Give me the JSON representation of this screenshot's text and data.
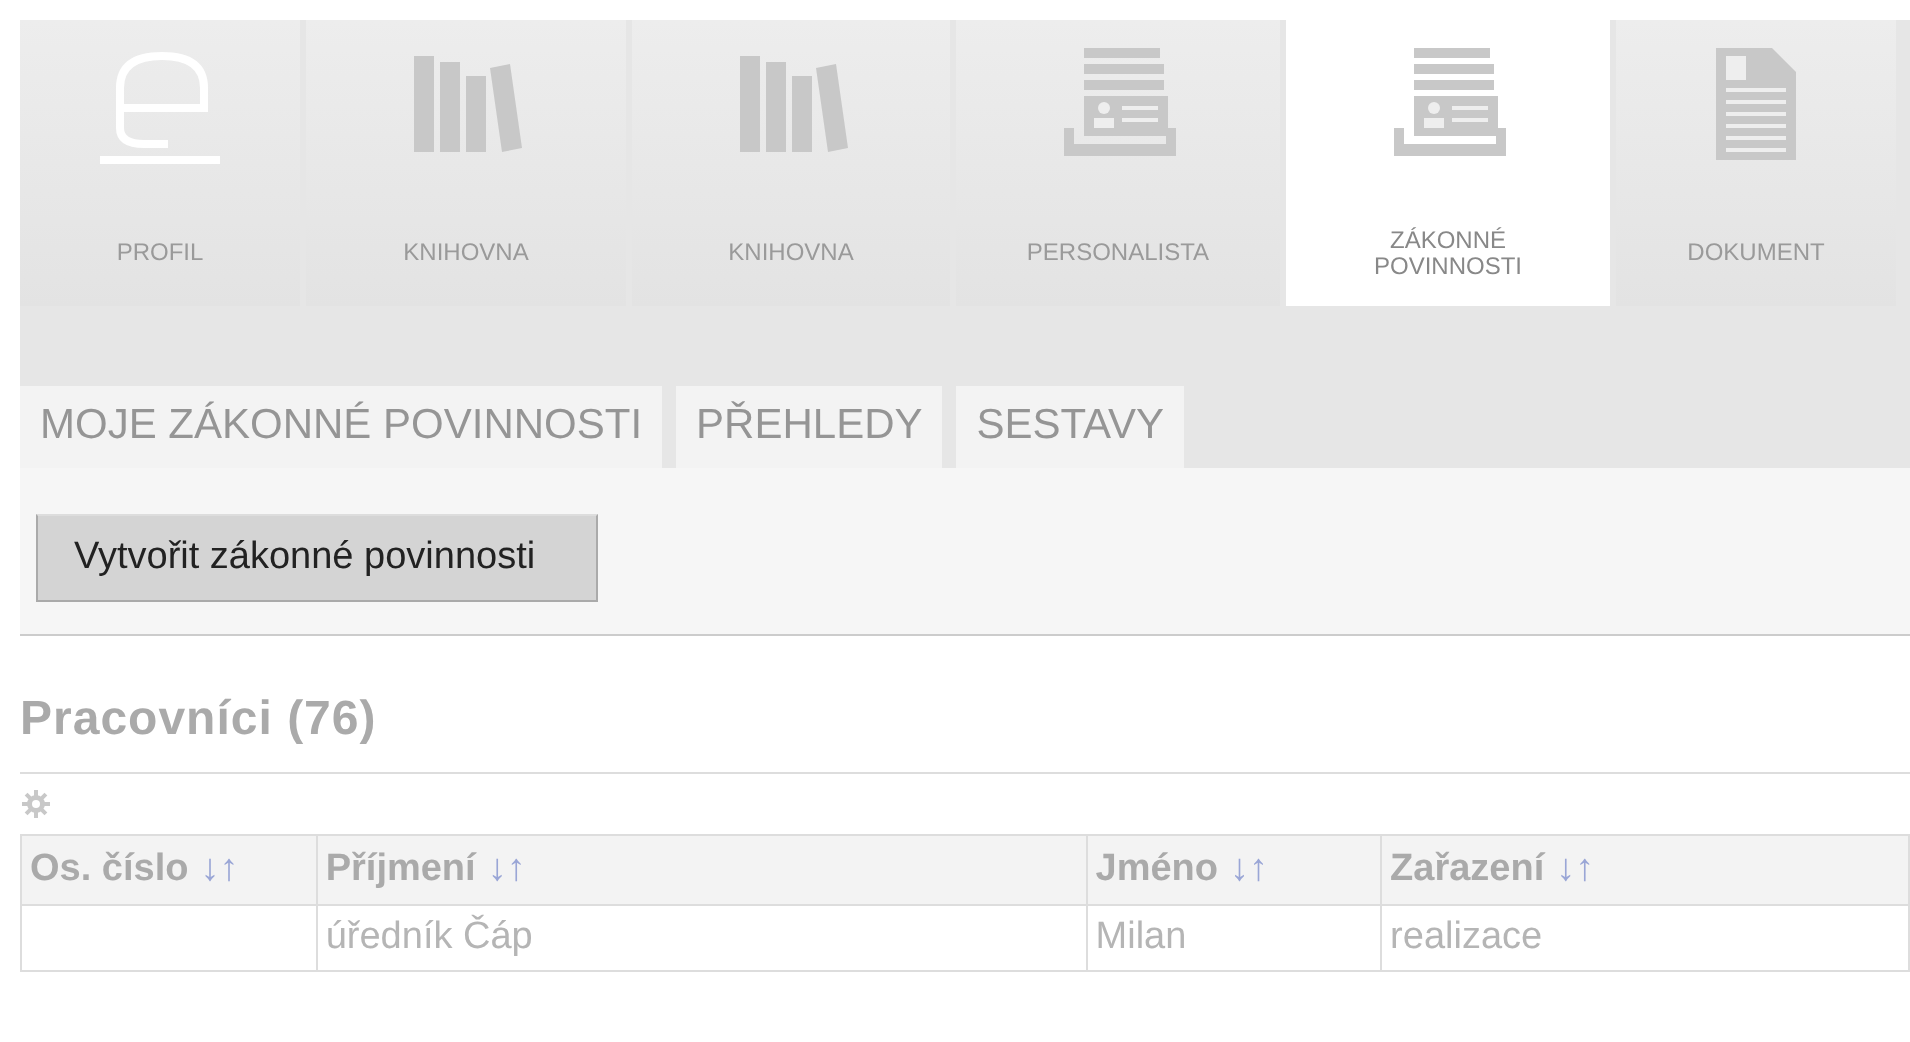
{
  "modules": [
    {
      "kind": "profile",
      "label": "PROFIL",
      "selected": false
    },
    {
      "kind": "library",
      "label": "KNIHOVNA",
      "selected": false
    },
    {
      "kind": "library",
      "label": "KNIHOVNA",
      "selected": false
    },
    {
      "kind": "records",
      "label": "PERSONALISTA",
      "selected": false
    },
    {
      "kind": "records",
      "label": "ZÁKONNÉ POVINNOSTI",
      "selected": true
    },
    {
      "kind": "document",
      "label": "DOKUMENT",
      "selected": false
    }
  ],
  "subtabs": [
    {
      "label": "MOJE ZÁKONNÉ POVINNOSTI"
    },
    {
      "label": "PŘEHLEDY"
    },
    {
      "label": "SESTAVY"
    }
  ],
  "create_button": "Vytvořit zákonné povinnosti",
  "section_title": "Pracovníci (76)",
  "table": {
    "columns": [
      {
        "label": "Os. číslo",
        "sort": "↓↑"
      },
      {
        "label": "Příjmení",
        "sort": "↓↑"
      },
      {
        "label": "Jméno",
        "sort": "↓↑"
      },
      {
        "label": "Zařazení",
        "sort": "↓↑"
      }
    ],
    "rows": [
      [
        "",
        "úředník Čáp",
        "Milan",
        "realizace"
      ]
    ]
  }
}
